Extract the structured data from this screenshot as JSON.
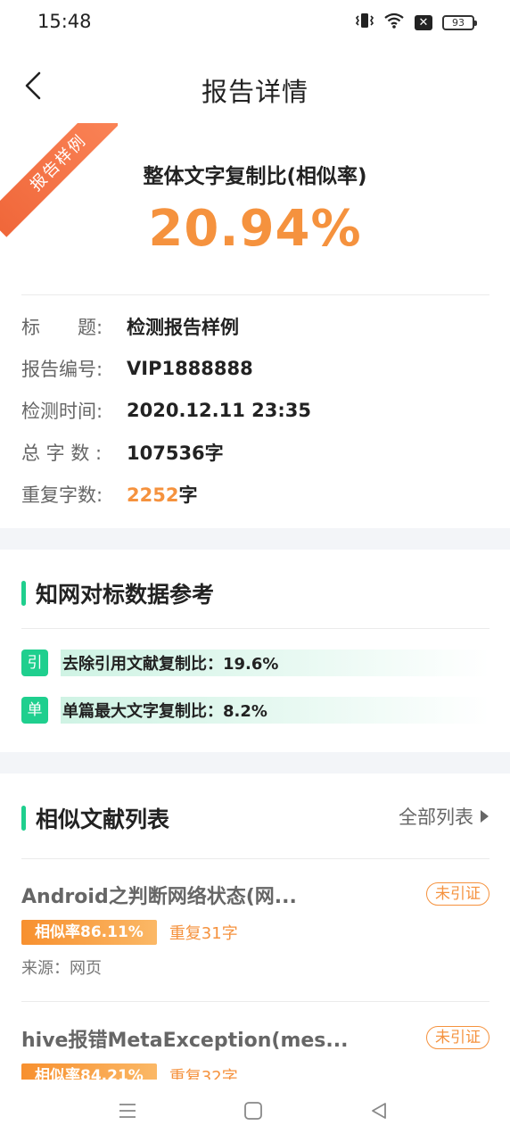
{
  "status_bar": {
    "time": "15:48",
    "battery": "93"
  },
  "nav": {
    "title": "报告详情"
  },
  "ribbon": {
    "label": "报告样例"
  },
  "summary": {
    "headline": "整体文字复制比(相似率)",
    "percent": "20.94%"
  },
  "info": [
    {
      "key": "标　　题:",
      "value": "检测报告样例"
    },
    {
      "key": "报告编号:",
      "value": "VIP1888888"
    },
    {
      "key": "检测时间:",
      "value": "2020.12.11 23:35"
    },
    {
      "key": "总 字 数 :",
      "value": "107536字"
    }
  ],
  "repeat_count": {
    "key": "重复字数:",
    "value": "2252",
    "unit": "字"
  },
  "benchmark": {
    "title": "知网对标数据参考",
    "items": [
      {
        "badge": "引",
        "text": "去除引用文献复制比：19.6%"
      },
      {
        "badge": "单",
        "text": "单篇最大文字复制比：8.2%"
      }
    ]
  },
  "similar": {
    "title": "相似文献列表",
    "all_link": "全部列表",
    "docs": [
      {
        "title": "Android之判断网络状态(网...",
        "tag": "未引证",
        "similarity": "相似率86.11%",
        "repeat": "重复31字",
        "source": "来源：网页"
      },
      {
        "title": "hive报错MetaException(mes...",
        "tag": "未引证",
        "similarity": "相似率84.21%",
        "repeat": "重复32字"
      }
    ]
  },
  "colors": {
    "accent_green": "#1fcf8e",
    "accent_orange": "#f5923e",
    "ribbon": "#f0673a"
  }
}
